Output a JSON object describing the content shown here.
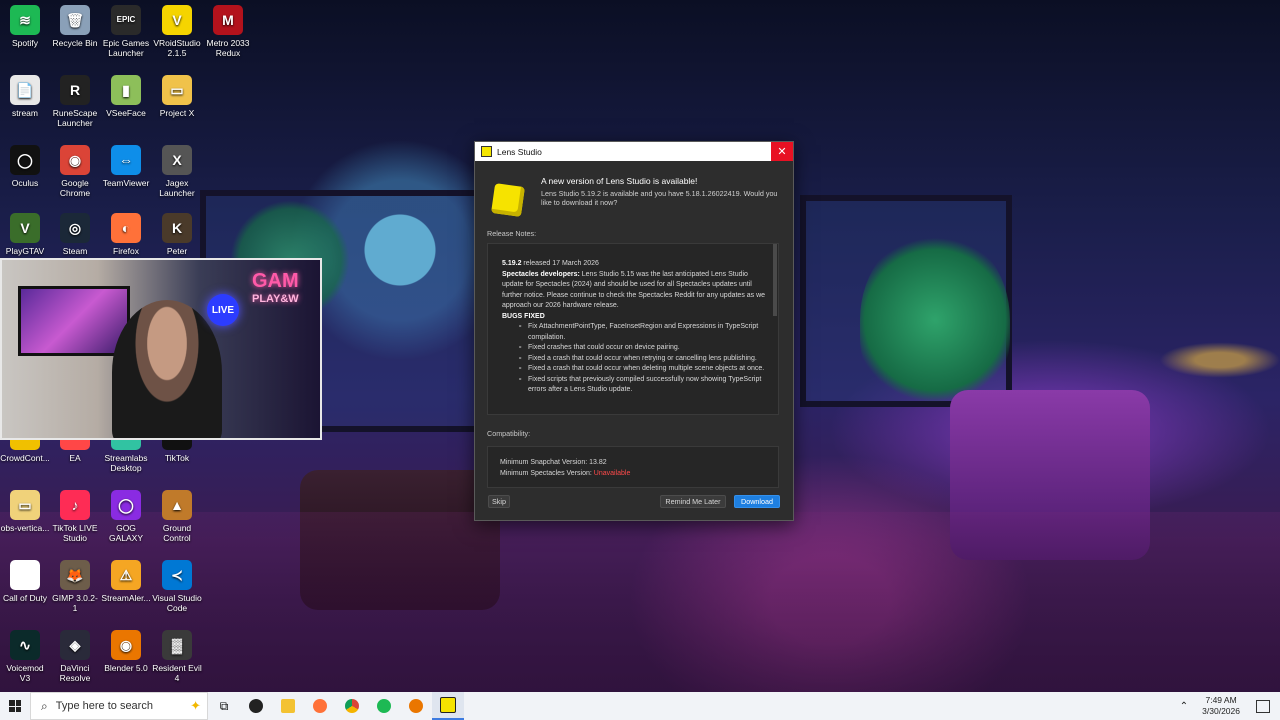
{
  "desktop": {
    "icons": [
      {
        "label": "Spotify",
        "glyph": "≋",
        "color": "#1db954"
      },
      {
        "label": "Recycle Bin",
        "glyph": "🗑",
        "color": "#8aa0b8"
      },
      {
        "label": "Epic Games Launcher",
        "glyph": "EPIC",
        "color": "#2a2a2a"
      },
      {
        "label": "VRoidStudio 2.1.5",
        "glyph": "V",
        "color": "#f5d400"
      },
      {
        "label": "Metro 2033 Redux",
        "glyph": "M",
        "color": "#b3121c"
      },
      {
        "label": "stream",
        "glyph": "📄",
        "color": "#e8e8e8"
      },
      {
        "label": "RuneScape Launcher",
        "glyph": "R",
        "color": "#222222"
      },
      {
        "label": "VSeeFace",
        "glyph": "▮",
        "color": "#8dbf5a"
      },
      {
        "label": "Project X",
        "glyph": "▭",
        "color": "#f0c24a"
      },
      {
        "label": "Oculus",
        "glyph": "◯",
        "color": "#111111"
      },
      {
        "label": "Google Chrome",
        "glyph": "◉",
        "color": "#db4437"
      },
      {
        "label": "TeamViewer",
        "glyph": "⇔",
        "color": "#0e8ee9"
      },
      {
        "label": "Jagex Launcher",
        "glyph": "X",
        "color": "#555555"
      },
      {
        "label": "PlayGTAV",
        "glyph": "V",
        "color": "#3a6d2a"
      },
      {
        "label": "Steam",
        "glyph": "◎",
        "color": "#1b2838"
      },
      {
        "label": "Firefox",
        "glyph": "◐",
        "color": "#ff7139"
      },
      {
        "label": "Peter",
        "glyph": "K",
        "color": "#4a3a2a"
      },
      {
        "label": "CrowdCont...",
        "glyph": "",
        "color": "#f0c000"
      },
      {
        "label": "EA",
        "glyph": "",
        "color": "#ff4747"
      },
      {
        "label": "Streamlabs Desktop",
        "glyph": "",
        "color": "#31c3a2"
      },
      {
        "label": "TikTok",
        "glyph": "",
        "color": "#111111"
      },
      {
        "label": "obs-vertica...",
        "glyph": "▭",
        "color": "#f0d27a"
      },
      {
        "label": "TikTok LIVE Studio",
        "glyph": "♪",
        "color": "#fe2c55"
      },
      {
        "label": "GOG GALAXY",
        "glyph": "◯",
        "color": "#8a2be2"
      },
      {
        "label": "Ground Control",
        "glyph": "▲",
        "color": "#c07a2a"
      },
      {
        "label": "Call of Duty",
        "glyph": "",
        "color": "#ffffff"
      },
      {
        "label": "GIMP 3.0.2-1",
        "glyph": "🦊",
        "color": "#6d5d4a"
      },
      {
        "label": "StreamAler...",
        "glyph": "⚠",
        "color": "#f5a623"
      },
      {
        "label": "Visual Studio Code",
        "glyph": "≺",
        "color": "#0078d4"
      },
      {
        "label": "Voicemod V3",
        "glyph": "∿",
        "color": "#0b2a2a"
      },
      {
        "label": "DaVinci Resolve",
        "glyph": "◈",
        "color": "#2a2a3a"
      },
      {
        "label": "Blender 5.0",
        "glyph": "◉",
        "color": "#ea7600"
      },
      {
        "label": "Resident Evil 4",
        "glyph": "▓",
        "color": "#3a3a3a"
      }
    ]
  },
  "webcam": {
    "live_badge": "LIVE",
    "neon_text": "GAM",
    "neon_sub": "PLAY&W"
  },
  "dialog": {
    "title": "Lens Studio",
    "close_icon": "✕",
    "heading": "A new version of Lens Studio is available!",
    "subtext": "Lens Studio 5.19.2 is available and you have 5.18.1.26022419. Would you like to download it now?",
    "release_notes_label": "Release Notes:",
    "release": {
      "version": "5.19.2",
      "released": " released 17 March 2026",
      "spectacles_label": "Spectacles developers:",
      "spectacles_text": " Lens Studio 5.15 was the last anticipated Lens Studio update for Spectacles (2024) and should be used for all Spectacles updates until further notice. Please continue to check the Spectacles Reddit for any updates as we approach our 2026 hardware release.",
      "bugs_label": "BUGS FIXED",
      "bugs": [
        "Fix AttachmentPointType, FaceInsetRegion and Expressions in TypeScript compilation.",
        "Fixed crashes that could occur on device pairing.",
        "Fixed a crash that could occur when retrying or cancelling lens publishing.",
        "Fixed a crash that could occur when deleting multiple scene objects at once.",
        "Fixed scripts that previously compiled successfully now showing TypeScript errors after a Lens Studio update."
      ]
    },
    "compat_label": "Compatibility:",
    "min_snapchat_label": "Minimum Snapchat Version: ",
    "min_snapchat_value": "13.82",
    "min_spectacles_label": "Minimum Spectacles Version: ",
    "min_spectacles_value": "Unavailable",
    "buttons": {
      "skip": "Skip",
      "remind": "Remind Me Later",
      "download": "Download"
    }
  },
  "taskbar": {
    "search_placeholder": "Type here to search",
    "time": "7:49 AM",
    "date": "3/30/2026"
  }
}
